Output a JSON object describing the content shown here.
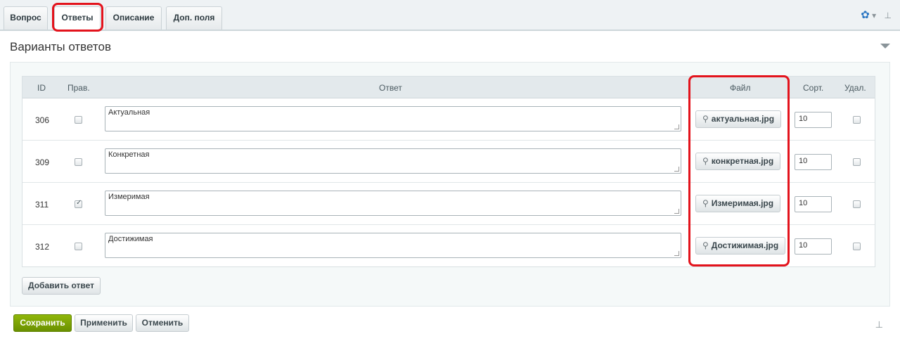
{
  "tabs": [
    {
      "label": "Вопрос"
    },
    {
      "label": "Ответы"
    },
    {
      "label": "Описание"
    },
    {
      "label": "Доп. поля"
    }
  ],
  "toolbar": {
    "gear_icon": "gear-icon",
    "pin_icon": "pin-icon"
  },
  "section": {
    "title": "Варианты ответов"
  },
  "table": {
    "columns": {
      "id": "ID",
      "correct": "Прав.",
      "answer": "Ответ",
      "file": "Файл",
      "sort": "Сорт.",
      "delete": "Удал."
    },
    "rows": [
      {
        "id": "306",
        "correct": false,
        "answer": "Актуальная",
        "file": "актуальная.jpg",
        "sort": "10",
        "delete": false
      },
      {
        "id": "309",
        "correct": false,
        "answer": "Конкретная",
        "file": "конкретная.jpg",
        "sort": "10",
        "delete": false
      },
      {
        "id": "311",
        "correct": true,
        "answer": "Измеримая",
        "file": "Измеримая.jpg",
        "sort": "10",
        "delete": false
      },
      {
        "id": "312",
        "correct": false,
        "answer": "Достижимая",
        "file": "Достижимая.jpg",
        "sort": "10",
        "delete": false
      }
    ]
  },
  "buttons": {
    "add_answer": "Добавить ответ",
    "save": "Сохранить",
    "apply": "Применить",
    "cancel": "Отменить"
  },
  "colors": {
    "highlight": "#e3131c",
    "save_green": "#7aa300",
    "gear_blue": "#2a76c2"
  }
}
